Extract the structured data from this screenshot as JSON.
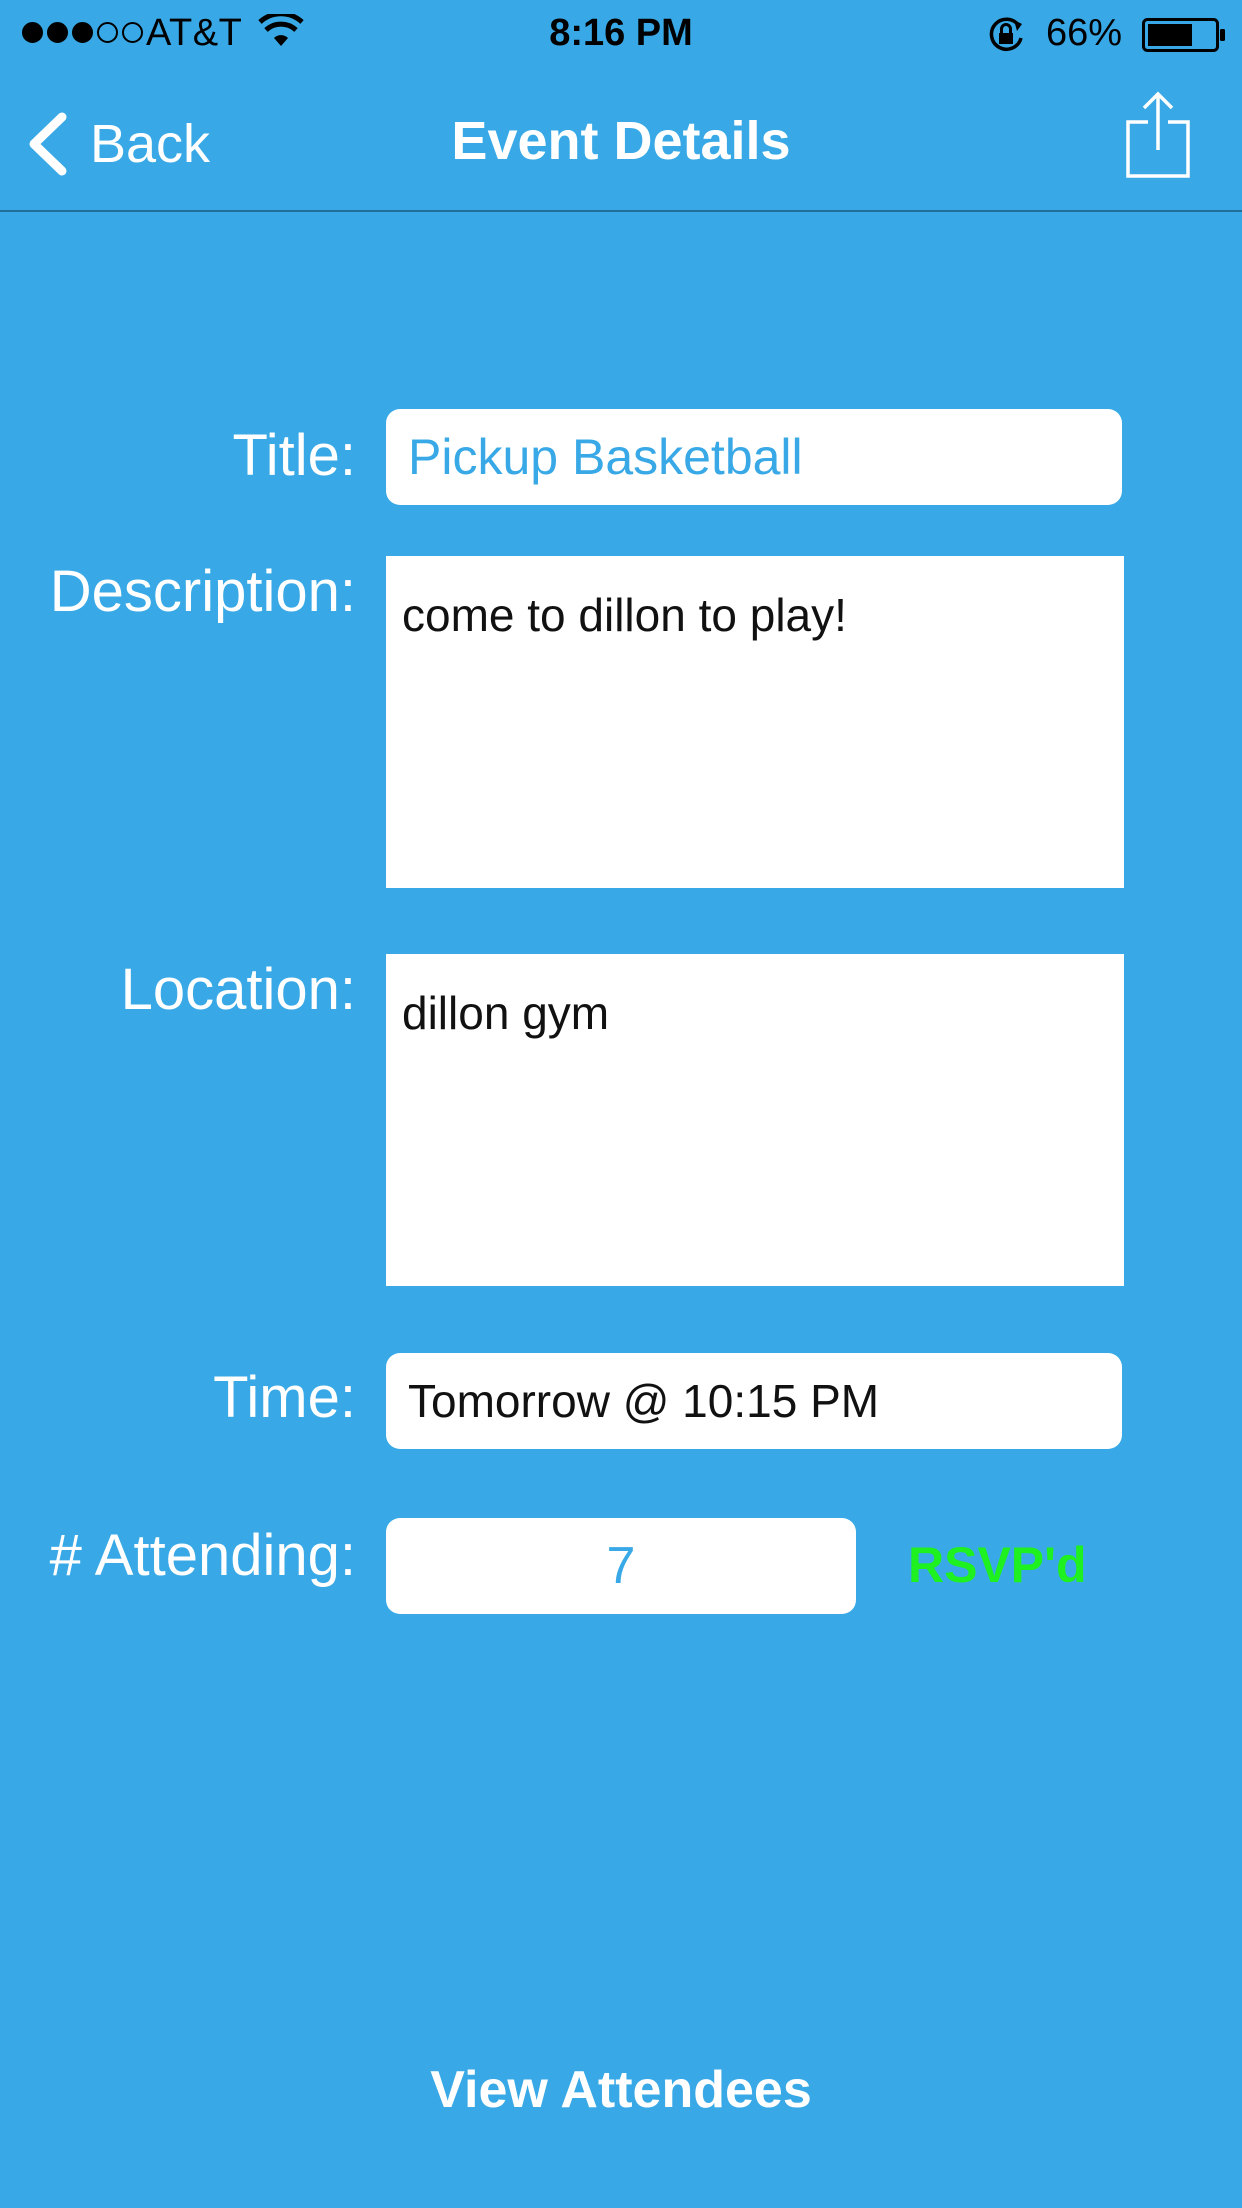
{
  "status_bar": {
    "signal": {
      "filled": 3,
      "total": 5
    },
    "carrier": "AT&T",
    "time": "8:16 PM",
    "battery_percent_text": "66%",
    "battery_level": 0.66,
    "icons": [
      "signal-dots-icon",
      "wifi-icon",
      "rotation-lock-icon",
      "battery-icon"
    ]
  },
  "nav": {
    "back_label": "Back",
    "title": "Event Details",
    "icons": [
      "chevron-left-icon",
      "share-icon"
    ]
  },
  "form": {
    "title_label": "Title:",
    "title_value": "Pickup Basketball",
    "description_label": "Description:",
    "description_value": "come to dillon to play!",
    "location_label": "Location:",
    "location_value": "dillon gym",
    "time_label": "Time:",
    "time_value": "Tomorrow @ 10:15 PM",
    "attending_label": "# Attending:",
    "attending_value": "7",
    "rsvp_status": "RSVP'd"
  },
  "footer": {
    "view_attendees_label": "View Attendees"
  },
  "colors": {
    "background": "#38a9e6",
    "accent_text": "#38a9e6",
    "rsvp": "#1ff01f",
    "label": "#ffffff"
  }
}
